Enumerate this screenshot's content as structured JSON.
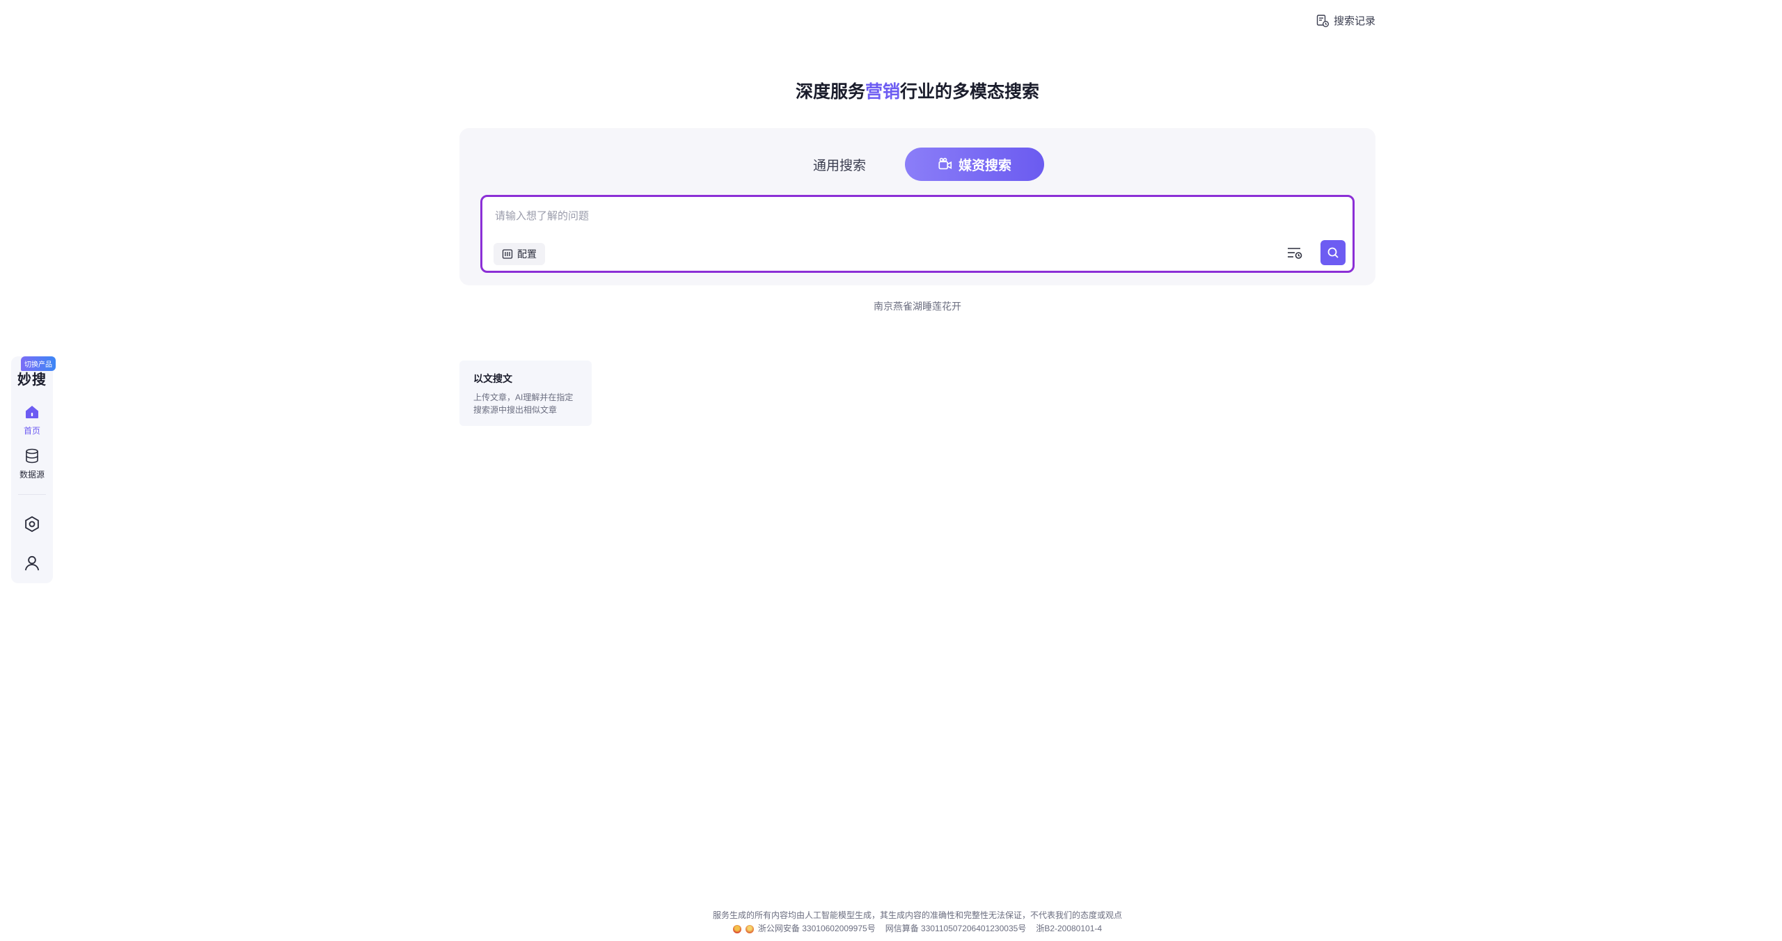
{
  "header": {
    "history_label": "搜索记录"
  },
  "sidebar": {
    "logo": "妙搜",
    "switch_badge": "切换产品",
    "items": [
      {
        "label": "首页",
        "icon": "home-icon",
        "active": true
      },
      {
        "label": "数据源",
        "icon": "database-icon",
        "active": false
      }
    ],
    "bottom_icons": [
      "settings-icon",
      "user-icon"
    ]
  },
  "headline": {
    "prefix": "深度服务",
    "highlight": "营销",
    "suffix": "行业的多模态搜索"
  },
  "search": {
    "tabs": [
      {
        "label": "通用搜索",
        "active": false
      },
      {
        "label": "媒资搜索",
        "active": true,
        "icon": "video-camera-icon"
      }
    ],
    "placeholder": "请输入想了解的问题",
    "config_label": "配置",
    "suggestion": "南京燕雀湖睡莲花开"
  },
  "cards": [
    {
      "title": "以文搜文",
      "description": "上传文章，AI理解并在指定搜索源中搜出相似文章"
    }
  ],
  "footer": {
    "disclaimer": "服务生成的所有内容均由人工智能模型生成，其生成内容的准确性和完整性无法保证，不代表我们的态度或观点",
    "police_record": "浙公网安备 33010602009975号",
    "algorithm_record": "网信算备 330110507206401230035号",
    "icp": "浙B2-20080101-4"
  },
  "colors": {
    "accent": "#6d5cf2",
    "search_border": "#8b2fd6",
    "panel_bg": "#f6f6fa"
  }
}
